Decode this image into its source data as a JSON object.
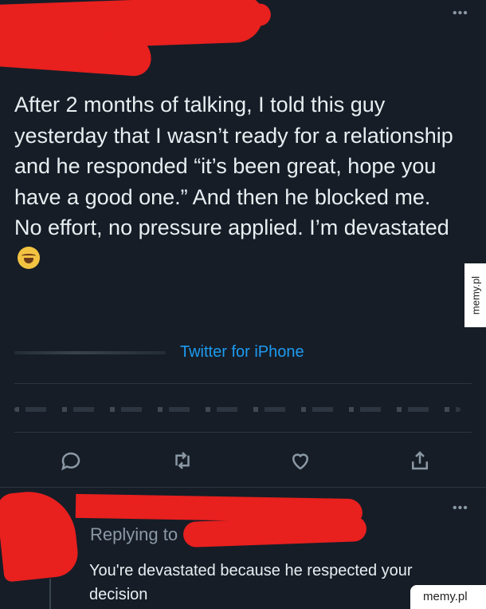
{
  "tweet": {
    "text": "After 2 months of talking, I told this guy yesterday that I wasn’t ready for a relationship and he responded “it’s been great, hope you have a good one.” And then he blocked me. No effort, no pressure applied. I’m devastated",
    "emoji": "loudly-crying-face-emoji",
    "source": "Twitter for iPhone",
    "more_label": "•••"
  },
  "actions": [
    {
      "name": "reply-icon"
    },
    {
      "name": "retweet-icon"
    },
    {
      "name": "like-icon"
    },
    {
      "name": "share-icon"
    }
  ],
  "reply": {
    "replying_label": "Replying to",
    "text": "You're devastated because he respected your decision",
    "more_label": "•••"
  },
  "watermark": {
    "side": "memy.pl",
    "bottom": "memy.pl"
  },
  "colors": {
    "background": "#161d27",
    "redaction": "#e8201e",
    "link": "#1d9bf0",
    "muted": "#8b98a5"
  }
}
